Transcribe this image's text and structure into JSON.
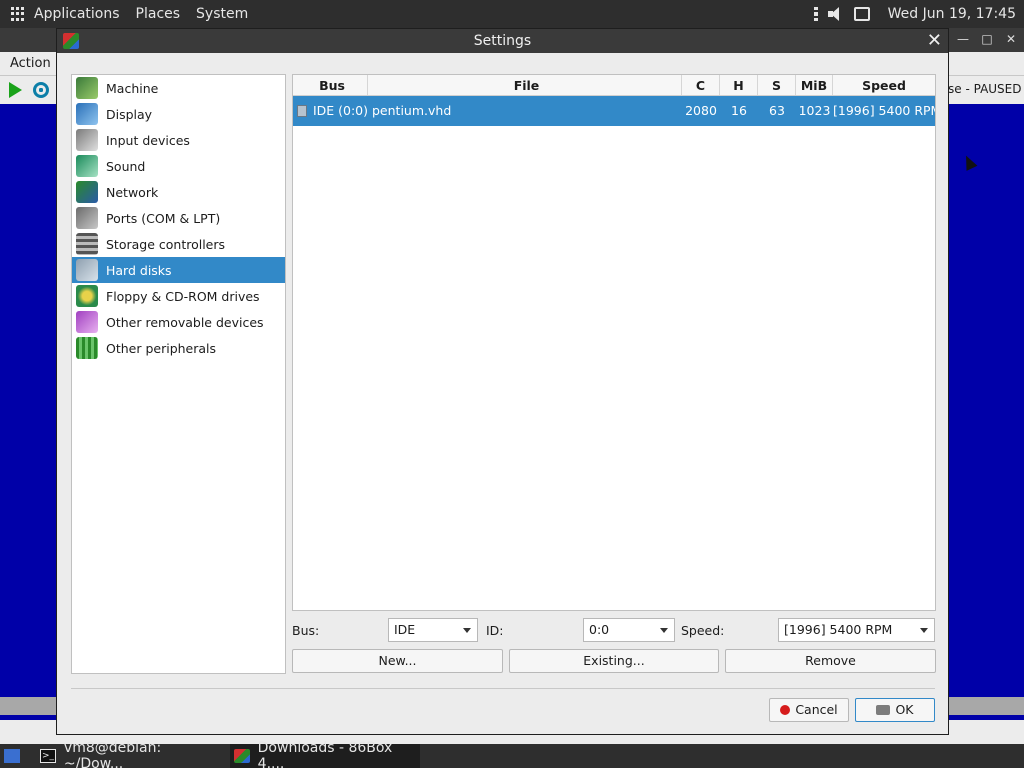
{
  "top_panel": {
    "menus": [
      "Applications",
      "Places",
      "System"
    ],
    "clock": "Wed Jun 19, 17:45"
  },
  "bg_window": {
    "menu_action": "Action",
    "status_text": "se - PAUSED"
  },
  "taskbar": {
    "items": [
      {
        "label": "vm8@debian: ~/Dow..."
      },
      {
        "label": "Downloads - 86Box 4...."
      }
    ]
  },
  "dialog": {
    "title": "Settings",
    "categories": [
      {
        "label": "Machine",
        "icon": "machine-icon"
      },
      {
        "label": "Display",
        "icon": "display-icon"
      },
      {
        "label": "Input devices",
        "icon": "input-devices-icon"
      },
      {
        "label": "Sound",
        "icon": "sound-icon"
      },
      {
        "label": "Network",
        "icon": "network-icon"
      },
      {
        "label": "Ports (COM & LPT)",
        "icon": "ports-icon"
      },
      {
        "label": "Storage controllers",
        "icon": "storage-icon"
      },
      {
        "label": "Hard disks",
        "icon": "hard-disk-icon",
        "selected": true
      },
      {
        "label": "Floppy & CD-ROM drives",
        "icon": "floppy-cdrom-icon"
      },
      {
        "label": "Other removable devices",
        "icon": "removable-icon"
      },
      {
        "label": "Other peripherals",
        "icon": "peripherals-icon"
      }
    ],
    "table": {
      "headers": [
        "Bus",
        "File",
        "C",
        "H",
        "S",
        "MiB",
        "Speed"
      ],
      "rows": [
        {
          "bus": "IDE (0:0)",
          "file": "pentium.vhd",
          "c": "2080",
          "h": "16",
          "s": "63",
          "mib": "1023",
          "speed": "[1996] 5400 RPM"
        }
      ]
    },
    "controls": {
      "bus_label": "Bus:",
      "bus_value": "IDE",
      "id_label": "ID:",
      "id_value": "0:0",
      "speed_label": "Speed:",
      "speed_value": "[1996] 5400 RPM"
    },
    "buttons": {
      "new": "New...",
      "existing": "Existing...",
      "remove": "Remove",
      "cancel": "Cancel",
      "ok": "OK"
    },
    "colors": {
      "selection": "#3289c8",
      "titlebar": "#3a3a3a",
      "desktop": "#0000a8"
    }
  }
}
